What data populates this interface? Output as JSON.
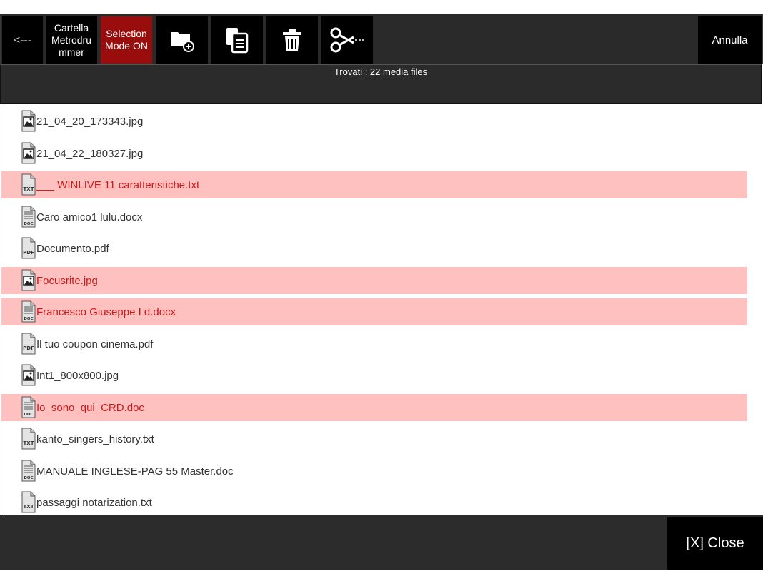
{
  "toolbar": {
    "back_label": "<---",
    "folder_label": "Cartella Metrodrummer",
    "selection_label": "Selection Mode ON",
    "new_folder_icon": "folder-plus-icon",
    "copy_icon": "copy-document-icon",
    "delete_icon": "trash-icon",
    "cut_icon": "scissors-icon",
    "cancel_label": "Annulla"
  },
  "info": {
    "found_text": "Trovati : 22 media files"
  },
  "files": [
    {
      "name": "21_04_20_173343.jpg",
      "type": "image",
      "selected": false
    },
    {
      "name": "21_04_22_180327.jpg",
      "type": "image",
      "selected": false
    },
    {
      "name": "___ WINLIVE 11 caratteristiche.txt",
      "type": "txt",
      "selected": true
    },
    {
      "name": "Caro amico1 lulu.docx",
      "type": "doc",
      "selected": false
    },
    {
      "name": "Documento.pdf",
      "type": "pdf",
      "selected": false
    },
    {
      "name": "Focusrite.jpg",
      "type": "image",
      "selected": true
    },
    {
      "name": "Francesco Giuseppe I d.docx",
      "type": "doc",
      "selected": true
    },
    {
      "name": "Il tuo coupon cinema.pdf",
      "type": "pdf",
      "selected": false
    },
    {
      "name": "Int1_800x800.jpg",
      "type": "image",
      "selected": false
    },
    {
      "name": "Io_sono_qui_CRD.doc",
      "type": "doc",
      "selected": true
    },
    {
      "name": "kanto_singers_history.txt",
      "type": "txt",
      "selected": false
    },
    {
      "name": "MANUALE INGLESE-PAG 55 Master.doc",
      "type": "doc",
      "selected": false
    },
    {
      "name": "passaggi notarization.txt",
      "type": "txt",
      "selected": false
    }
  ],
  "icon_labels": {
    "txt": "TXT",
    "doc": "DOC",
    "pdf": "PDF"
  },
  "footer": {
    "close_label": "[X] Close"
  },
  "colors": {
    "selected_row_bg": "#ffc0c0",
    "selected_text": "#cc1a1a",
    "selection_button": "#990d0d"
  }
}
